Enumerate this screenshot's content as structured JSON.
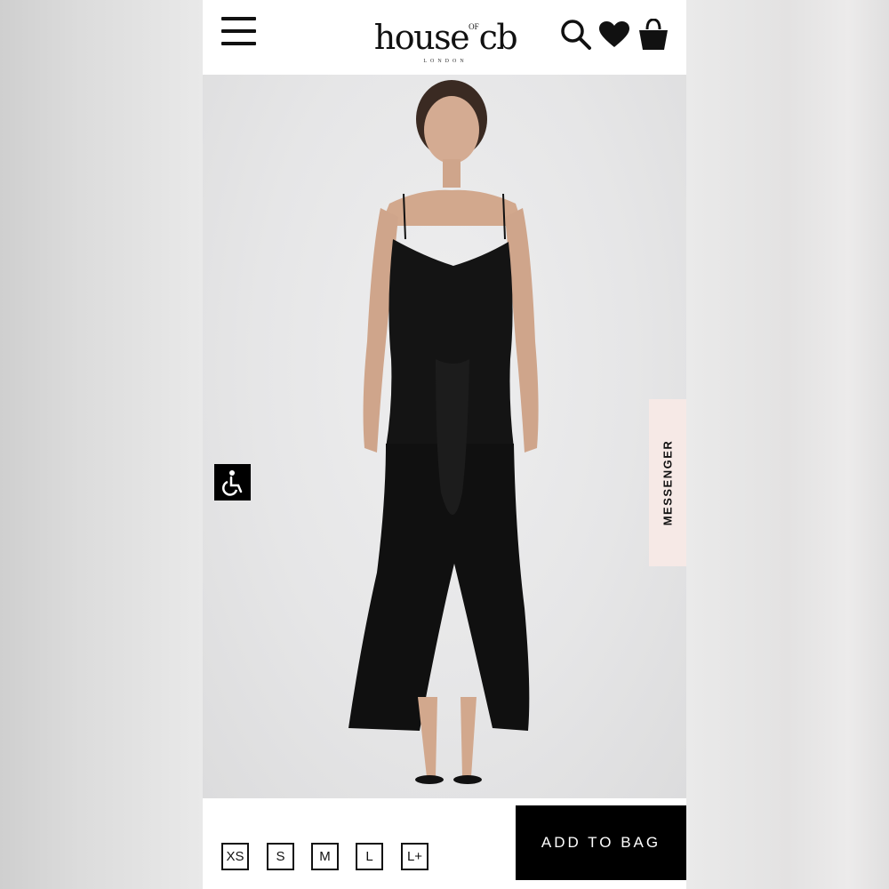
{
  "brand": {
    "logo_main": "house",
    "logo_of": "OF",
    "logo_tail": "cb",
    "logo_sub": "LONDON"
  },
  "header": {
    "icons": [
      "menu-icon",
      "search-icon",
      "heart-icon",
      "bag-icon"
    ]
  },
  "product": {
    "image_description_icon": "product-photo",
    "sizes": [
      "XS",
      "S",
      "M",
      "L",
      "L+"
    ],
    "add_to_bag": "ADD TO BAG"
  },
  "widgets": {
    "messenger": "MESSENGER",
    "accessibility_icon": "wheelchair-icon"
  },
  "colors": {
    "primary": "#000000",
    "messenger_bg": "#f6e9e6",
    "hero_bg": "#e6e6e7"
  }
}
